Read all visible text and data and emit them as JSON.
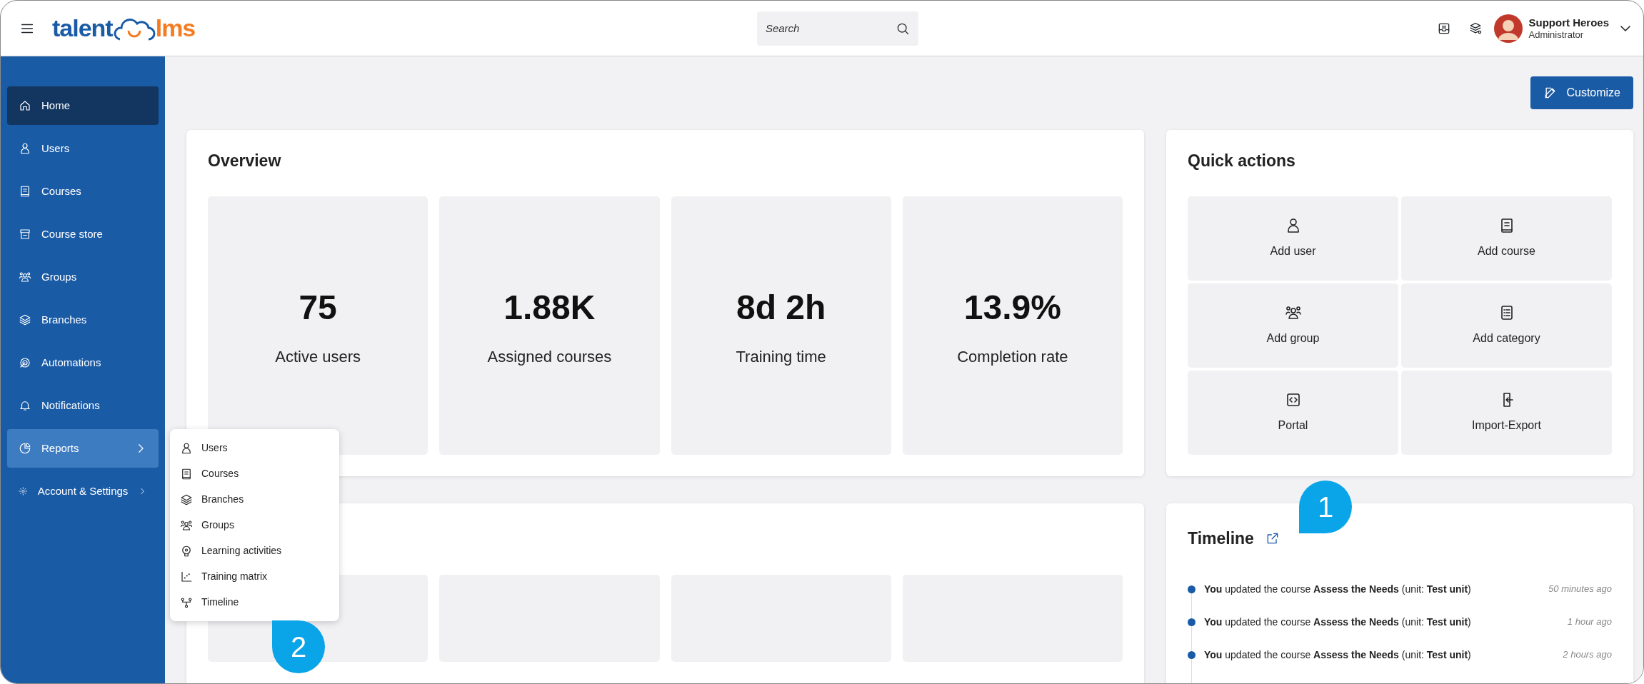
{
  "header": {
    "logo": [
      "talent",
      "lms"
    ],
    "search": {
      "placeholder": "Search"
    },
    "user": {
      "name": "Support Heroes",
      "role": "Administrator"
    }
  },
  "sidebar": {
    "items": [
      {
        "label": "Home",
        "kind": "link",
        "selected": true
      },
      {
        "label": "Users",
        "kind": "link",
        "selected": false
      },
      {
        "label": "Courses",
        "kind": "link",
        "selected": false
      },
      {
        "label": "Course store",
        "kind": "link",
        "selected": false
      },
      {
        "label": "Groups",
        "kind": "link",
        "selected": false
      },
      {
        "label": "Branches",
        "kind": "link",
        "selected": false
      },
      {
        "label": "Automations",
        "kind": "link",
        "selected": false
      },
      {
        "label": "Notifications",
        "kind": "link",
        "selected": false
      },
      {
        "label": "Reports",
        "kind": "menu",
        "selected": false,
        "expanded": true
      },
      {
        "label": "Account & Settings",
        "kind": "menu",
        "selected": false,
        "expanded": false
      }
    ]
  },
  "reports_menu": {
    "items": [
      "Users",
      "Courses",
      "Branches",
      "Groups",
      "Learning activities",
      "Training matrix",
      "Timeline"
    ]
  },
  "customize_button": "Customize",
  "overview": {
    "title": "Overview",
    "stats": [
      {
        "value": "75",
        "label": "Active users"
      },
      {
        "value": "1.88K",
        "label": "Assigned courses"
      },
      {
        "value": "8d 2h",
        "label": "Training time"
      },
      {
        "value": "13.9%",
        "label": "Completion rate"
      }
    ]
  },
  "quick_actions": {
    "title": "Quick actions",
    "items": [
      "Add user",
      "Add course",
      "Add group",
      "Add category",
      "Portal",
      "Import-Export"
    ]
  },
  "timeline": {
    "title": "Timeline",
    "entries": [
      {
        "text": "**You** updated the course **Assess the Needs** (unit: **Test unit**)",
        "time": "50 minutes ago"
      },
      {
        "text": "**You** updated the course **Assess the Needs** (unit: **Test unit**)",
        "time": "1 hour ago"
      },
      {
        "text": "**You** updated the course **Assess the Needs** (unit: **Test unit**)",
        "time": "2 hours ago"
      }
    ]
  },
  "callouts": [
    "1",
    "2"
  ]
}
